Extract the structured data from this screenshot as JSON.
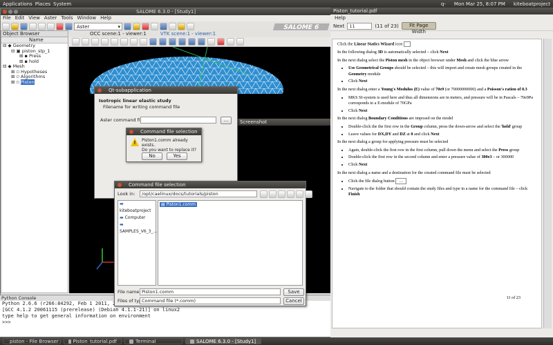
{
  "topbar": {
    "menus": [
      "Applications",
      "Places",
      "System"
    ],
    "right": [
      "q-",
      "Mon Mar 25, 8:07 PM",
      "kiteboatproject"
    ]
  },
  "salome": {
    "title": "SALOME 6.3.0 - [Study1]",
    "menu": [
      "File",
      "Edit",
      "View",
      "Aster",
      "Tools",
      "Window",
      "Help"
    ],
    "module_combo": "Aster",
    "logo": "SALOME 6",
    "object_browser": {
      "title": "Object Browser",
      "column": "Name",
      "items": [
        {
          "label": "Geometry",
          "indent": 0
        },
        {
          "label": "piston_stp_1",
          "indent": 1
        },
        {
          "label": "Press",
          "indent": 2
        },
        {
          "label": "hold",
          "indent": 2
        },
        {
          "label": "Mesh",
          "indent": 0
        },
        {
          "label": "Hypotheses",
          "indent": 1
        },
        {
          "label": "Algorithms",
          "indent": 1
        },
        {
          "label": "Piston",
          "indent": 1
        }
      ]
    },
    "view_tabs": [
      "OCC scene:1 - viewer:1",
      "VTK scene:1 - viewer:1"
    ],
    "screenshot_bar": "Screenshot",
    "python_console": {
      "title": "Python Console",
      "lines": [
        "Python 2.6.6 (r266:84292, Feb  1 2011, 22:50:52)",
        "[GCC 4.1.2 20061115 (prerelease) (Debian 4.1.1-21)] on linux2",
        "type help to get general information on environment",
        ">>>"
      ]
    }
  },
  "qt_sub": {
    "title": "Qt-subapplication",
    "heading": "Isotropic linear elastic study",
    "subheading": "Filename for writing command file",
    "field_label": "Aster command file:"
  },
  "cfs_confirm": {
    "title": "Command file selection",
    "message": [
      "Piston1.comm already exists.",
      "Do you want to replace it?"
    ],
    "no": "No",
    "yes": "Yes"
  },
  "cfs_dialog": {
    "title": "Command file selection",
    "look_in_label": "Look in:",
    "look_in": "/opt/caelinux/docs/tutorials/piston",
    "places": [
      "kiteboatproject",
      "Computer",
      "SAMPLES_V6_3_..."
    ],
    "files": [
      "Piston1.comm"
    ],
    "filename_label": "File name:",
    "filename": "Piston1.comm",
    "filetype_label": "Files of type:",
    "filetype": "Command file (*.comm)",
    "save": "Save",
    "cancel": "Cancel"
  },
  "pdf": {
    "title": "Piston_tutorial.pdf",
    "menu": [
      "Help"
    ],
    "next_label": "Next",
    "page_input": "11",
    "page_count": "(11 of 23)",
    "zoom": "Fit Page Width",
    "page_number": "11 of 23"
  },
  "taskbar": [
    "piston - File Browser",
    "Piston_tutorial.pdf",
    "Terminal",
    "SALOME 6.3.0 - [Study1]"
  ]
}
